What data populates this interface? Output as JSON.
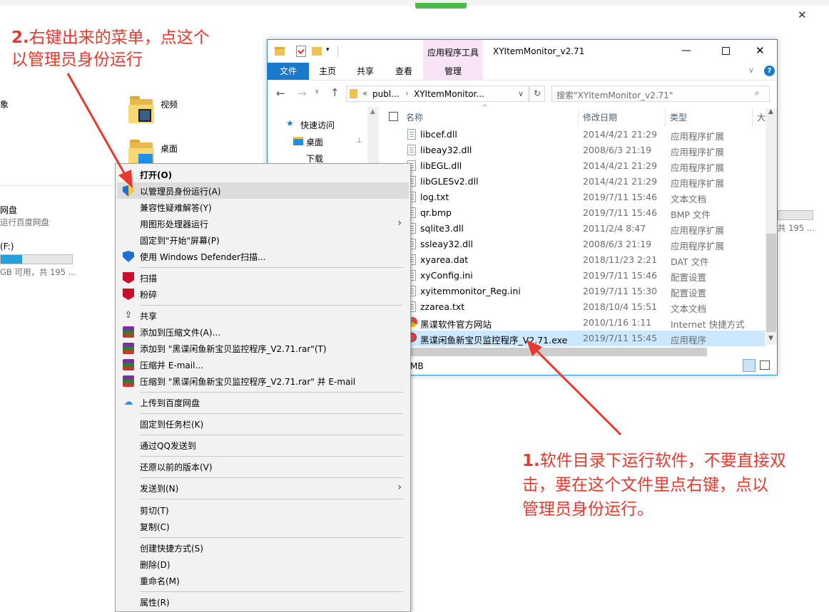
{
  "background": {
    "items": [
      {
        "label": "象"
      },
      {
        "label": "视频"
      },
      {
        "label": "桌面"
      },
      {
        "label": "网盘"
      },
      {
        "label": "运行百度网盘"
      },
      {
        "label": "(F:)"
      },
      {
        "label": "GB 可用，共 195 ..."
      }
    ],
    "right_drive_sub": "共 195 ..."
  },
  "annotations": {
    "step2_num": "2.",
    "step2_line1": "右键出来的菜单，点这个",
    "step2_line2": "以管理员身份运行",
    "step1_num": "1.",
    "step1_line1": "软件目录下运行软件，不要直接双",
    "step1_line2": "击，要在这个文件里点右键，点以",
    "step1_line3": "管理员身份运行。"
  },
  "window": {
    "title": "XYItemMonitor_v2.71",
    "context_tab": "应用程序工具",
    "tabs": [
      "文件",
      "主页",
      "共享",
      "查看",
      "管理"
    ],
    "address": [
      "publ...",
      "XYItemMonitor..."
    ],
    "address_prefix": "«",
    "search_placeholder": "搜索\"XYItemMonitor_v2.71\"",
    "nav": {
      "quick_access": "快速访问",
      "desktop": "桌面",
      "downloads": "下载"
    },
    "columns": {
      "name": "名称",
      "date": "修改日期",
      "type": "类型",
      "size": "大"
    },
    "files": [
      {
        "name": "libcef.dll",
        "date": "2014/4/21 21:29",
        "type": "应用程序扩展"
      },
      {
        "name": "libeay32.dll",
        "date": "2008/6/3 21:19",
        "type": "应用程序扩展"
      },
      {
        "name": "libEGL.dll",
        "date": "2014/4/21 21:29",
        "type": "应用程序扩展"
      },
      {
        "name": "libGLESv2.dll",
        "date": "2014/4/21 21:29",
        "type": "应用程序扩展"
      },
      {
        "name": "log.txt",
        "date": "2019/7/11 15:46",
        "type": "文本文档"
      },
      {
        "name": "qr.bmp",
        "date": "2019/7/11 15:46",
        "type": "BMP 文件"
      },
      {
        "name": "sqlite3.dll",
        "date": "2011/2/4 8:47",
        "type": "应用程序扩展"
      },
      {
        "name": "ssleay32.dll",
        "date": "2008/6/3 21:19",
        "type": "应用程序扩展"
      },
      {
        "name": "xyarea.dat",
        "date": "2018/11/23 2:21",
        "type": "DAT 文件"
      },
      {
        "name": "xyConfig.ini",
        "date": "2019/7/11 15:46",
        "type": "配置设置"
      },
      {
        "name": "xyitemmonitor_Reg.ini",
        "date": "2019/7/11 15:30",
        "type": "配置设置"
      },
      {
        "name": "zzarea.txt",
        "date": "2018/10/4 15:51",
        "type": "文本文档"
      },
      {
        "name": "黑谍软件官方网站",
        "date": "2010/1/16 1:11",
        "type": "Internet 快捷方式"
      },
      {
        "name": "黑谍闲鱼新宝贝监控程序_V2.71.exe",
        "date": "2019/7/11 15:45",
        "type": "应用程序"
      }
    ],
    "status": "MB"
  },
  "context_menu": {
    "open": "打开(O)",
    "run_as_admin": "以管理员身份运行(A)",
    "compat": "兼容性疑难解答(Y)",
    "gpu": "用图形处理器运行",
    "pin_start": "固定到\"开始\"屏幕(P)",
    "defender": "使用 Windows Defender扫描...",
    "scan": "扫描",
    "shred": "粉碎",
    "share": "共享",
    "add_archive": "添加到压缩文件(A)...",
    "add_rar": "添加到 \"黑谍闲鱼新宝贝监控程序_V2.71.rar\"(T)",
    "zip_email": "压缩并 E-mail...",
    "zip_rar_email": "压缩到 \"黑谍闲鱼新宝贝监控程序_V2.71.rar\" 并 E-mail",
    "baidu": "上传到百度网盘",
    "pin_taskbar": "固定到任务栏(K)",
    "qq": "通过QQ发送到",
    "restore": "还原以前的版本(V)",
    "sendto": "发送到(N)",
    "cut": "剪切(T)",
    "copy": "复制(C)",
    "shortcut": "创建快捷方式(S)",
    "delete": "删除(D)",
    "rename": "重命名(M)",
    "properties": "属性(R)"
  },
  "colors": {
    "accent": "#1979ca",
    "annotation": "#e8382f",
    "selection": "#cce8ff"
  }
}
